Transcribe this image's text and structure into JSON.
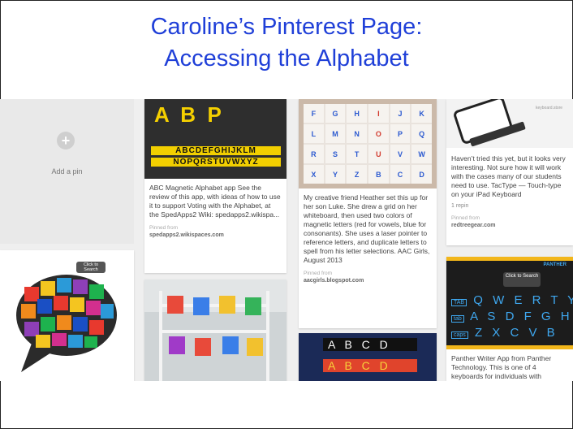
{
  "title": {
    "line1": "Caroline’s Pinterest Page:",
    "line2": "Accessing the Alphabet"
  },
  "add_pin": {
    "label": "Add a pin",
    "icon": "plus-icon"
  },
  "pins": {
    "abc_app": {
      "image_letters": "A  B  P",
      "image_band1": "ABCDEFGHIJKLM",
      "image_band2": "NOPQRSTUVWXYZ",
      "description": "ABC Magnetic Alphabet app See the review of this app, with ideas of how to use it to support Voting with the Alphabet, at the SpedApps2 Wiki: spedapps2.wikispa...",
      "pinned_from_label": "Pinned from",
      "source": "spedapps2.wikispaces.com"
    },
    "magnetic_letters": {
      "grid_letters": [
        "F",
        "G",
        "H",
        "I",
        "J",
        "K",
        "L",
        "M",
        "N",
        "O",
        "P",
        "Q",
        "R",
        "S",
        "T",
        "U",
        "V",
        "W",
        "X",
        "Y",
        "Z",
        "B",
        "C",
        "D"
      ],
      "description": "My creative friend Heather set this up for her son Luke. She drew a grid on her whiteboard, then used two colors of magnetic letters (red for vowels, blue for consonants). She uses a laser pointer to reference letters, and duplicate letters to spell from his letter selections. AAC Girls, August 2013",
      "pinned_from_label": "Pinned from",
      "source": "aacgirls.blogspot.com"
    },
    "tactype": {
      "image_caption": "keyboard.store",
      "description": "Haven’t tried this yet, but it looks very interesting. Not sure how it will work with the cases many of our students need to use. TacType — Touch-type on your iPad Keyboard",
      "repin": "1 repin",
      "pinned_from_label": "Pinned from",
      "source": "redtreegear.com"
    },
    "panther": {
      "brand": "PANTHER",
      "search_button": "Click to Search",
      "row1_key": "TAB",
      "row1": "Q W E R T Y",
      "row2_key": "tab",
      "row2": "A S D F G H",
      "row3_key": "caps",
      "row3": "Z X C V B",
      "description": "Panther Writer App from Panther Technology. This is one of 4 keyboards for individuals with"
    },
    "abcd_board": {
      "row1": "A B C D",
      "row2": "A B C D"
    },
    "bubble": {
      "badge": "Click to Search"
    }
  },
  "colors": {
    "title": "#1f3fd8",
    "board_bg": "#efefef"
  }
}
